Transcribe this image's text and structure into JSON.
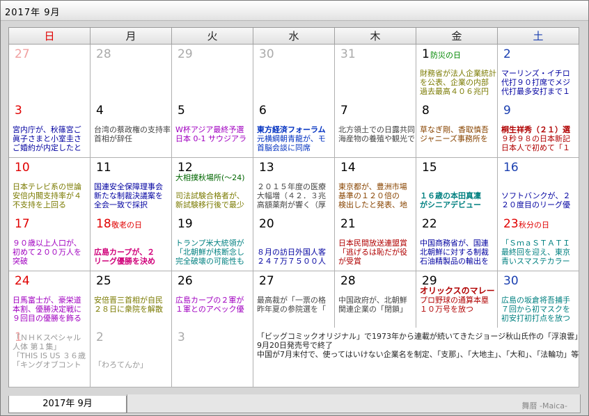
{
  "title": "2017年 9月",
  "tab_label": "2017年 9月",
  "brand": "舞暦 -Maica-",
  "weekdays": [
    "日",
    "月",
    "火",
    "水",
    "木",
    "金",
    "土"
  ],
  "weeks": [
    [
      {
        "d": "27",
        "other": true
      },
      {
        "d": "28",
        "other": true
      },
      {
        "d": "29",
        "other": true
      },
      {
        "d": "30",
        "other": true
      },
      {
        "d": "31",
        "other": true
      },
      {
        "d": "1",
        "hol": "防災の日",
        "ev": [
          {
            "t": "",
            "c": ""
          },
          {
            "t": "財務省が法人企業統計",
            "c": "c-olive"
          },
          {
            "t": "を公表、企業の内部",
            "c": "c-olive"
          },
          {
            "t": "過去最高４０６兆円",
            "c": "c-olive"
          }
        ]
      },
      {
        "d": "2",
        "ev": [
          {
            "t": "",
            "c": ""
          },
          {
            "t": "マーリンズ・イチロ",
            "c": "c-navy"
          },
          {
            "t": "代打９０打席でメジ",
            "c": "c-navy"
          },
          {
            "t": "代打最多安打まで１",
            "c": "c-navy"
          }
        ]
      }
    ],
    [
      {
        "d": "3",
        "ev": [
          {
            "t": "",
            "c": ""
          },
          {
            "t": "宮内庁が、秋篠宮ご",
            "c": "c-navy"
          },
          {
            "t": "眞子さまと小室圭さ",
            "c": "c-navy"
          },
          {
            "t": "ご婚約が内定したと",
            "c": "c-navy"
          }
        ]
      },
      {
        "d": "4",
        "ev": [
          {
            "t": "",
            "c": ""
          },
          {
            "t": "台湾の蔡政権の支持率",
            "c": "c-gray"
          },
          {
            "t": "首相が辞任",
            "c": "c-gray"
          }
        ]
      },
      {
        "d": "5",
        "ev": [
          {
            "t": "",
            "c": ""
          },
          {
            "t": "W杯アジア最終予選",
            "c": "c-purple"
          },
          {
            "t": "日本 0-1 サウジアラ",
            "c": "c-purple"
          }
        ]
      },
      {
        "d": "6",
        "ev": [
          {
            "t": "",
            "c": ""
          },
          {
            "t": "東方経済フォーラム",
            "c": "c-blue",
            "b": true
          },
          {
            "t": "元横綱朝青龍が、モ",
            "c": "c-blue"
          },
          {
            "t": "首脳会談に同席",
            "c": "c-blue"
          }
        ]
      },
      {
        "d": "7",
        "ev": [
          {
            "t": "",
            "c": ""
          },
          {
            "t": "北方領土での日露共同",
            "c": "c-gray"
          },
          {
            "t": "海産物の養殖や観光で",
            "c": "c-gray"
          }
        ]
      },
      {
        "d": "8",
        "ev": [
          {
            "t": "",
            "c": ""
          },
          {
            "t": "草なぎ剛、香取慎吾",
            "c": "c-brown"
          },
          {
            "t": "ジャニーズ事務所を",
            "c": "c-brown"
          }
        ]
      },
      {
        "d": "9",
        "ev": [
          {
            "t": "",
            "c": ""
          },
          {
            "t": "桐生祥秀（２１）選",
            "c": "c-red",
            "b": true
          },
          {
            "t": "９秒９８の日本新記",
            "c": "c-red"
          },
          {
            "t": "日本人で初めて「１",
            "c": "c-red"
          }
        ]
      }
    ],
    [
      {
        "d": "10",
        "ev": [
          {
            "t": "",
            "c": ""
          },
          {
            "t": "日本テレビ系の世論",
            "c": "c-olive"
          },
          {
            "t": "安倍内閣支持率が４",
            "c": "c-olive"
          },
          {
            "t": "不支持を上回る",
            "c": "c-olive"
          }
        ]
      },
      {
        "d": "11",
        "ev": [
          {
            "t": "",
            "c": ""
          },
          {
            "t": "国連安全保障理事会",
            "c": "c-navy"
          },
          {
            "t": "新たな制裁決議案を",
            "c": "c-navy"
          },
          {
            "t": "全会一致で採択",
            "c": "c-navy"
          }
        ]
      },
      {
        "d": "12",
        "ev": [
          {
            "t": "大相撲秋場所(～24)",
            "c": "c-dkgreen"
          },
          {
            "t": "",
            "c": ""
          },
          {
            "t": "司法試験合格者が、",
            "c": "c-olive"
          },
          {
            "t": "新試験移行後で最少",
            "c": "c-olive"
          }
        ]
      },
      {
        "d": "13",
        "ev": [
          {
            "t": "",
            "c": ""
          },
          {
            "t": "２０１５年度の医療",
            "c": "c-gray"
          },
          {
            "t": "大幅増（４２．３兆",
            "c": "c-gray"
          },
          {
            "t": "高額薬剤が響く（厚",
            "c": "c-gray"
          }
        ]
      },
      {
        "d": "14",
        "ev": [
          {
            "t": "",
            "c": ""
          },
          {
            "t": "東京都が、豊洲市場",
            "c": "c-brown"
          },
          {
            "t": "基準の１２０倍の",
            "c": "c-brown"
          },
          {
            "t": "検出したと発表、地",
            "c": "c-brown"
          }
        ]
      },
      {
        "d": "15",
        "ev": [
          {
            "t": "",
            "c": ""
          },
          {
            "t": "",
            "c": ""
          },
          {
            "t": "１６歳の本田真凜",
            "c": "c-teal",
            "b": true
          },
          {
            "t": "がシニアデビュー",
            "c": "c-teal",
            "b": true
          }
        ]
      },
      {
        "d": "16",
        "ev": [
          {
            "t": "",
            "c": ""
          },
          {
            "t": "",
            "c": ""
          },
          {
            "t": "ソフトバンクが、２",
            "c": "c-navy"
          },
          {
            "t": "２０度目のリーグ優",
            "c": "c-navy"
          }
        ]
      }
    ],
    [
      {
        "d": "17",
        "ev": [
          {
            "t": "",
            "c": ""
          },
          {
            "t": "９０歳以上人口が、",
            "c": "c-purple"
          },
          {
            "t": "初めて２００万人を",
            "c": "c-purple"
          },
          {
            "t": "突破",
            "c": "c-purple"
          }
        ]
      },
      {
        "d": "18",
        "hol": "敬老の日",
        "sun": true,
        "ev": [
          {
            "t": "",
            "c": ""
          },
          {
            "t": "",
            "c": ""
          },
          {
            "t": "広島カープが、２",
            "c": "c-pink",
            "b": true
          },
          {
            "t": "リーグ優勝を決め",
            "c": "c-pink",
            "b": true
          }
        ]
      },
      {
        "d": "19",
        "ev": [
          {
            "t": "",
            "c": ""
          },
          {
            "t": "トランプ米大統領が",
            "c": "c-teal"
          },
          {
            "t": "「北朝鮮が核断念し",
            "c": "c-teal"
          },
          {
            "t": "完全破壊の可能性も",
            "c": "c-teal"
          }
        ]
      },
      {
        "d": "20",
        "ev": [
          {
            "t": "",
            "c": ""
          },
          {
            "t": "",
            "c": ""
          },
          {
            "t": "８月の訪日外国人客",
            "c": "c-navy"
          },
          {
            "t": "２４７万７５００人",
            "c": "c-navy"
          }
        ]
      },
      {
        "d": "21",
        "ev": [
          {
            "t": "",
            "c": ""
          },
          {
            "t": "日本民間放送連盟賞",
            "c": "c-red"
          },
          {
            "t": "「逃げるは恥だが役",
            "c": "c-red"
          },
          {
            "t": "が受賞",
            "c": "c-red"
          }
        ]
      },
      {
        "d": "22",
        "ev": [
          {
            "t": "",
            "c": ""
          },
          {
            "t": "中国商務省が、国連",
            "c": "c-navy"
          },
          {
            "t": "北朝鮮に対する制裁",
            "c": "c-navy"
          },
          {
            "t": "石油精製品の輸出を",
            "c": "c-navy"
          }
        ]
      },
      {
        "d": "23",
        "hol": "秋分の日",
        "sun": true,
        "ev": [
          {
            "t": "",
            "c": ""
          },
          {
            "t": "「ＳｍａＳＴＡＴＩ",
            "c": "c-teal"
          },
          {
            "t": "最終回を迎え、東京",
            "c": "c-teal"
          },
          {
            "t": "青いスマステカラー",
            "c": "c-teal"
          }
        ]
      }
    ],
    [
      {
        "d": "24",
        "ev": [
          {
            "t": "",
            "c": ""
          },
          {
            "t": "日馬富士が、豪栄道",
            "c": "c-purple"
          },
          {
            "t": "本割、優勝決定戦に",
            "c": "c-purple"
          },
          {
            "t": "９回目の優勝を飾る",
            "c": "c-purple"
          }
        ]
      },
      {
        "d": "25",
        "ev": [
          {
            "t": "",
            "c": ""
          },
          {
            "t": "安倍晋三首相が自民",
            "c": "c-olive"
          },
          {
            "t": "２８日に衆院を解散",
            "c": "c-olive"
          }
        ]
      },
      {
        "d": "26",
        "ev": [
          {
            "t": "",
            "c": ""
          },
          {
            "t": "広島カープの２軍が",
            "c": "c-purple"
          },
          {
            "t": "１軍とのアベック優",
            "c": "c-purple"
          }
        ]
      },
      {
        "d": "27",
        "ev": [
          {
            "t": "",
            "c": ""
          },
          {
            "t": "最高裁が「一票の格",
            "c": "c-gray"
          },
          {
            "t": "昨年夏の参院選を「",
            "c": "c-gray"
          }
        ]
      },
      {
        "d": "28",
        "ev": [
          {
            "t": "",
            "c": ""
          },
          {
            "t": "中国政府が、北朝鮮",
            "c": "c-gray"
          },
          {
            "t": "関連企業の「閉鎖」",
            "c": "c-gray"
          }
        ]
      },
      {
        "d": "29",
        "ev": [
          {
            "t": "オリックスのマレー",
            "c": "c-red",
            "b": true,
            "big": true
          },
          {
            "t": "プロ野球の通算本塁",
            "c": "c-red"
          },
          {
            "t": "１０万号を放つ",
            "c": "c-red"
          }
        ]
      },
      {
        "d": "30",
        "ev": [
          {
            "t": "",
            "c": ""
          },
          {
            "t": "広島の坂倉将吾捕手",
            "c": "c-teal"
          },
          {
            "t": "７回から初マスクを",
            "c": "c-teal"
          },
          {
            "t": "初安打初打点を放つ",
            "c": "c-teal"
          }
        ]
      }
    ],
    [
      {
        "d": "1",
        "other": true,
        "sunother": true,
        "ev": [
          {
            "t": "「ＮＨＫスペシャル",
            "c": "c-lgray"
          },
          {
            "t": "人体 第１集」",
            "c": "c-lgray"
          },
          {
            "t": "「THIS IS US ３６歳",
            "c": "c-lgray"
          },
          {
            "t": "「キングオブコント",
            "c": "c-lgray"
          }
        ]
      },
      {
        "d": "2",
        "other": true,
        "ev": [
          {
            "t": "",
            "c": ""
          },
          {
            "t": "",
            "c": ""
          },
          {
            "t": "",
            "c": ""
          },
          {
            "t": "「わろてんか」",
            "c": "c-lgray"
          }
        ]
      },
      {
        "d": "3",
        "other": true
      }
    ]
  ],
  "wide_note": [
    "「ビッグコミックオリジナル」で1973年から連載が続いてきたジョージ秋山氏作の「浮浪雲」が",
    "9月20日発売号で終了",
    "中国が7月末付で、使ってはいけない企業名を制定、「支那」、「大地主」、「大和」、「法輪功」等"
  ]
}
